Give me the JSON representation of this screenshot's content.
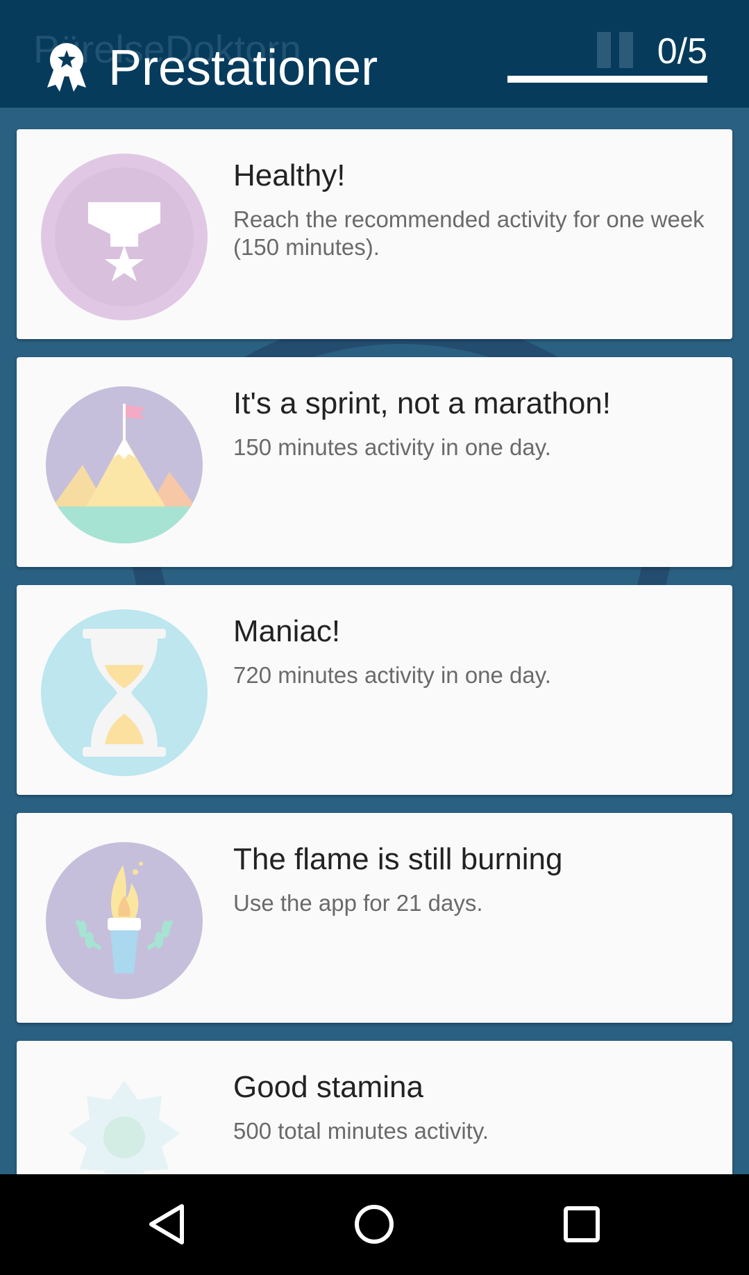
{
  "appbar": {
    "ghost_title": "PürelseDoktorn",
    "title": "Prestationer",
    "progress_text": "0/5",
    "progress_fraction": 0,
    "icon": "award-ribbon-icon"
  },
  "achievements": [
    {
      "title": "Healthy!",
      "description": "Reach the recommended activity for one week (150 minutes).",
      "icon": "medal-star-icon",
      "color": "#e0c8e4"
    },
    {
      "title": "It's a sprint, not a marathon!",
      "description": "150 minutes activity in one day.",
      "icon": "mountain-flag-icon",
      "color": "#c6bfdb"
    },
    {
      "title": "Maniac!",
      "description": "720 minutes activity in one day.",
      "icon": "hourglass-icon",
      "color": "#bde6ee"
    },
    {
      "title": "The flame is still burning",
      "description": "Use the app for 21 days.",
      "icon": "torch-icon",
      "color": "#c6bfdb"
    },
    {
      "title": "Good stamina",
      "description": "500 total minutes activity.",
      "icon": "sun-badge-icon",
      "color": "#e6f3f6"
    }
  ],
  "navbar": {
    "back": "back-triangle-icon",
    "home": "home-circle-icon",
    "recents": "recents-square-icon"
  }
}
